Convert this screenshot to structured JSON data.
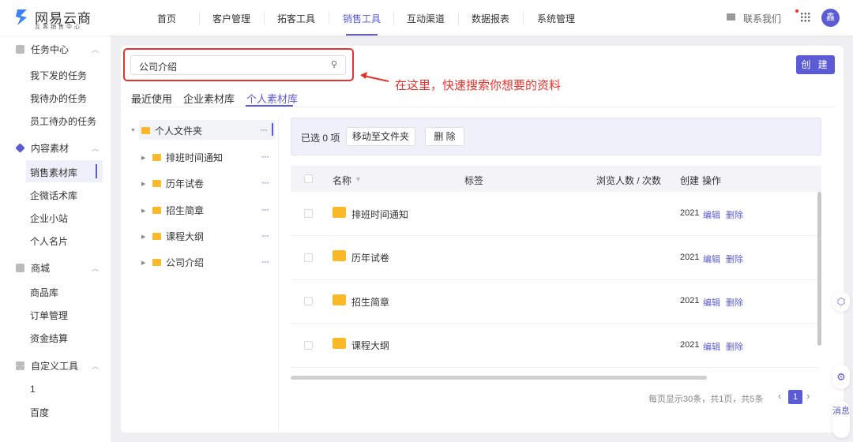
{
  "header": {
    "brand": "网易云商",
    "brand_sub": "互客销售中心",
    "nav": [
      "首页",
      "客户管理",
      "拓客工具",
      "销售工具",
      "互动渠道",
      "数据报表",
      "系统管理"
    ],
    "active_nav": "销售工具",
    "contact": "联系我们",
    "avatar": "鑫"
  },
  "sidebar": {
    "groups": [
      {
        "label": "任务中心",
        "items": [
          "我下发的任务",
          "我待办的任务",
          "员工待办的任务"
        ]
      },
      {
        "label": "内容素材",
        "items": [
          "销售素材库",
          "企微话术库",
          "企业小站",
          "个人名片"
        ]
      },
      {
        "label": "商城",
        "items": [
          "商品库",
          "订单管理",
          "资金结算"
        ]
      },
      {
        "label": "自定义工具",
        "items": [
          "1",
          "百度"
        ]
      }
    ],
    "active_item": "销售素材库"
  },
  "main": {
    "search_value": "公司介绍",
    "annotation": "在这里，快速搜索你想要的资料",
    "create_label": "创 建",
    "tabs": [
      "最近使用",
      "企业素材库",
      "个人素材库"
    ],
    "active_tab": "个人素材库",
    "tree": {
      "root": "个人文件夹",
      "children": [
        "排班时间通知",
        "历年试卷",
        "招生简章",
        "课程大纲",
        "公司介绍"
      ]
    },
    "toolbar": {
      "selected": "已选 0 项",
      "move": "移动至文件夹",
      "delete": "删 除"
    },
    "columns": [
      "名称",
      "标签",
      "浏览人数 / 次数",
      "创建",
      "操作"
    ],
    "rows": [
      {
        "name": "排班时间通知",
        "created": "2021",
        "edit": "编辑",
        "del": "删除"
      },
      {
        "name": "历年试卷",
        "created": "2021",
        "edit": "编辑",
        "del": "删除"
      },
      {
        "name": "招生简章",
        "created": "2021",
        "edit": "编辑",
        "del": "删除"
      },
      {
        "name": "课程大纲",
        "created": "2021",
        "edit": "编辑",
        "del": "删除"
      }
    ],
    "pagination": {
      "info": "每页显示30条，共1页，共5条",
      "page": "1"
    }
  },
  "float": {
    "message": "消息"
  },
  "colors": {
    "accent": "#5b5bd6",
    "annotation": "#e8322c",
    "folder": "#fbb928"
  }
}
